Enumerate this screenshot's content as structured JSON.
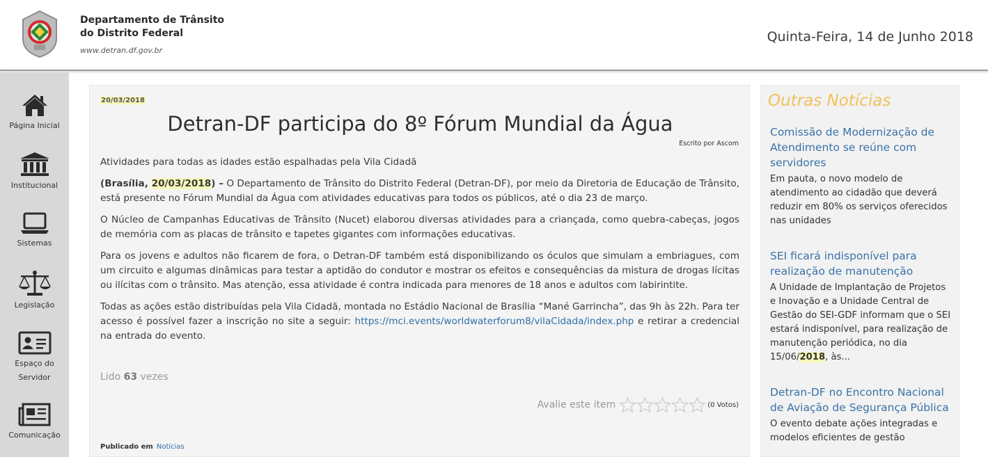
{
  "header": {
    "org_line1": "Departamento de Trânsito",
    "org_line2": "do Distrito Federal",
    "site": "www.detran.df.gov.br",
    "date": "Quinta-Feira, 14 de Junho 2018"
  },
  "sidebar": {
    "items": [
      {
        "label": "Página Inicial",
        "icon": "home-icon"
      },
      {
        "label": "Institucional",
        "icon": "institution-icon"
      },
      {
        "label": "Sistemas",
        "icon": "laptop-icon"
      },
      {
        "label": "Legislação",
        "icon": "scales-icon"
      },
      {
        "label": "Espaço do Servidor",
        "icon": "id-card-icon"
      },
      {
        "label": "Comunicação",
        "icon": "newspaper-icon"
      }
    ]
  },
  "article": {
    "date": "20/03/2018",
    "title": "Detran-DF participa do 8º Fórum Mundial da Água",
    "author": "Escrito por Ascom",
    "lead": "Atividades para todas as idades estão espalhadas pela Vila Cidadã",
    "p1_open": "(Brasília, ",
    "p1_date": "20/03/2018",
    "p1_close": ") –",
    "p1_text": " O Departamento de Trânsito do Distrito Federal (Detran-DF), por meio da Diretoria de Educação de Trânsito, está presente no Fórum Mundial da Água com atividades educativas para todos os públicos, até o dia 23 de março.",
    "p2": "O Núcleo de Campanhas Educativas de Trânsito (Nucet) elaborou diversas atividades para a criançada, como quebra-cabeças, jogos de memória com as placas de trânsito e tapetes gigantes com informações educativas.",
    "p3": "Para os jovens e adultos não ficarem de fora, o Detran-DF também está disponibilizando os óculos que simulam a embriagues, com um circuito e algumas dinâmicas para testar a aptidão do condutor e mostrar os efeitos e consequências da mistura de drogas lícitas ou ilícitas com o trânsito. Mas atenção, essa atividade é contra indicada para menores de 18 anos e adultos com labirintite.",
    "p4_before": "Todas as ações estão distribuídas pela Vila Cidadã, montada no Estádio Nacional de Brasília “Mané Garrincha”, das 9h às 22h. Para ter acesso é possível fazer a inscrição no site a seguir: ",
    "p4_link": "https://mci.events/worldwaterforum8/vilaCidada/index.php",
    "p4_after": " e retirar a credencial na entrada do evento.",
    "hits_before": "Lido ",
    "hits_count": "63",
    "hits_after": " vezes",
    "rating_label": "Avalie este item",
    "rating_value": 0,
    "rating_max": 5,
    "votes": "(0 Votos)",
    "published_label": "Publicado em",
    "published_category": "Notícias"
  },
  "aside": {
    "title": "Outras Notícias",
    "news": [
      {
        "title": "Comissão de Modernização de Atendimento se reúne com servidores",
        "desc": "Em pauta, o novo modelo de atendimento ao cidadão que deverá reduzir em 80% os serviços oferecidos nas unidades"
      },
      {
        "title": "SEI ficará indisponível para realização de manutenção",
        "desc_before": "A Unidade de Implantação de Projetos e Inovação e a Unidade Central de Gestão do SEI-GDF informam que o SEI estará indisponível, para realização de manutenção periódica, no dia 15/06/",
        "desc_hl": "2018",
        "desc_after": ", às..."
      },
      {
        "title": "Detran-DF no Encontro Nacional de Aviação de Segurança Pública",
        "desc": "O evento debate ações integradas e modelos eficientes de gestão"
      }
    ]
  },
  "colors": {
    "accent_gold": "#f0c15a",
    "link_blue": "#3a72a8",
    "highlight": "#f7f7b8",
    "sidebar_bg": "#d8d8d8"
  }
}
